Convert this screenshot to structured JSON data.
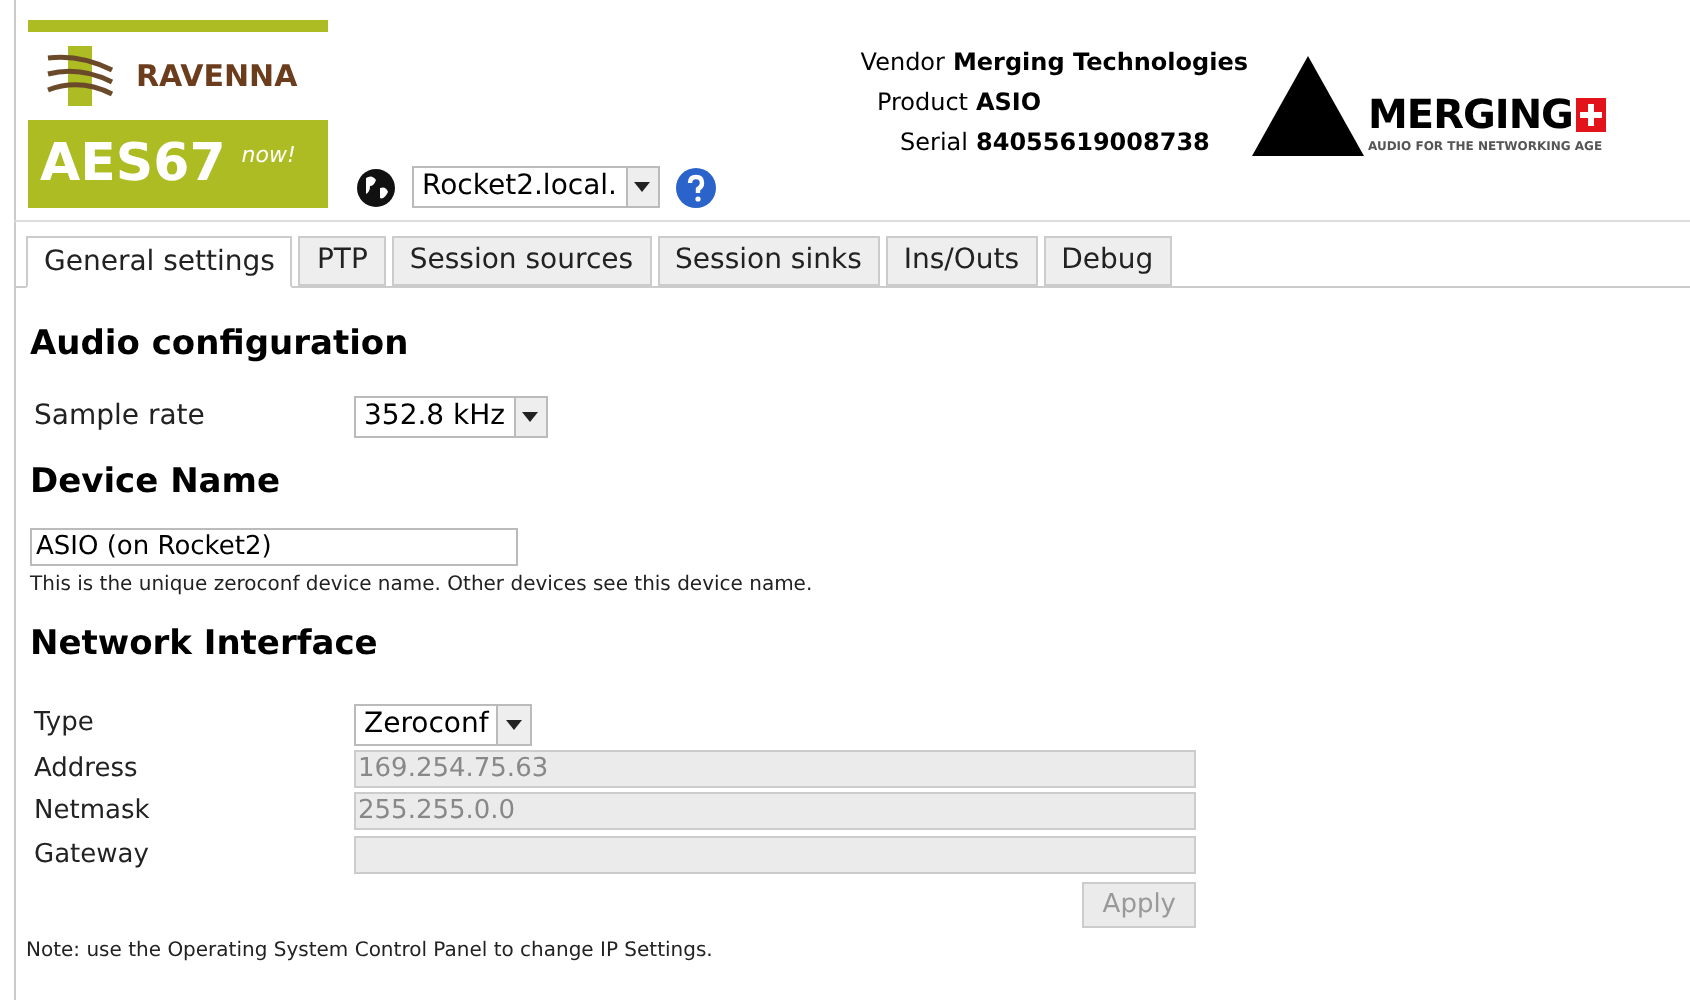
{
  "header": {
    "logo": {
      "brand": "RAVENNA",
      "standard": "AES67",
      "tag": "now!"
    },
    "host_select": {
      "value": "Rocket2.local."
    },
    "info": [
      {
        "label": "Vendor",
        "value": "Merging Technologies"
      },
      {
        "label": "Product",
        "value": "ASIO"
      },
      {
        "label": "Serial",
        "value": "84055619008738"
      }
    ],
    "company_logo": {
      "name": "MERGING",
      "tagline": "AUDIO FOR THE NETWORKING AGE"
    }
  },
  "tabs": [
    {
      "label": "General settings",
      "selected": true
    },
    {
      "label": "PTP",
      "selected": false
    },
    {
      "label": "Session sources",
      "selected": false
    },
    {
      "label": "Session sinks",
      "selected": false
    },
    {
      "label": "Ins/Outs",
      "selected": false
    },
    {
      "label": "Debug",
      "selected": false
    }
  ],
  "audio": {
    "title": "Audio configuration",
    "sample_rate_label": "Sample rate",
    "sample_rate": "352.8 kHz"
  },
  "device": {
    "title": "Device Name",
    "value": "ASIO (on Rocket2)",
    "help": "This is the unique zeroconf device name. Other devices see this device name."
  },
  "network": {
    "title": "Network Interface",
    "type_label": "Type",
    "type": "Zeroconf",
    "fields": [
      {
        "label": "Address",
        "value": "169.254.75.63",
        "disabled": true
      },
      {
        "label": "Netmask",
        "value": "255.255.0.0",
        "disabled": true
      },
      {
        "label": "Gateway",
        "disabled": true
      }
    ],
    "apply": {
      "label": "Apply",
      "disabled": true
    },
    "note": "Note: use the Operating System Control Panel to change IP Settings."
  }
}
